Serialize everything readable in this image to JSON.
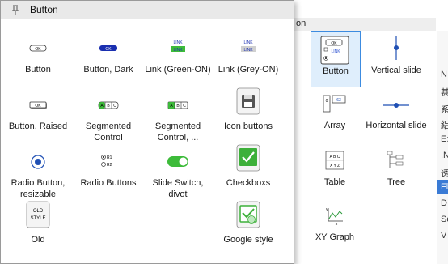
{
  "popup": {
    "title": "Button",
    "items": [
      {
        "label": "Button"
      },
      {
        "label": "Button, Dark"
      },
      {
        "label": "Link (Green-ON)"
      },
      {
        "label": "Link (Grey-ON)"
      },
      {
        "label": "Button, Raised"
      },
      {
        "label": "Segmented Control"
      },
      {
        "label": "Segmented Control, ..."
      },
      {
        "label": "Icon buttons"
      },
      {
        "label": "Radio Button, resizable"
      },
      {
        "label": "Radio Buttons"
      },
      {
        "label": "Slide Switch, divot"
      },
      {
        "label": "Checkboxs"
      },
      {
        "label": "Old"
      },
      {
        "label": "Google style"
      }
    ],
    "icon_text": {
      "ok": "OK",
      "link": "LINK",
      "segments": [
        "A",
        "B",
        "C"
      ],
      "radio_labels": [
        "R1",
        "R2"
      ],
      "old_style": [
        "OLD",
        "STYLE"
      ]
    }
  },
  "background": {
    "header_partial": "on",
    "items": [
      {
        "label": "Button"
      },
      {
        "label": "Vertical slide"
      },
      {
        "label": "Array"
      },
      {
        "label": "Horizontal slide"
      },
      {
        "label": "Table"
      },
      {
        "label": "Tree"
      },
      {
        "label": "XY Graph"
      }
    ],
    "icon_text": {
      "ok": "OK",
      "link": "LINK",
      "array_index": "0",
      "array_val": "63",
      "table_rows": [
        "A B C",
        "X Y Z"
      ],
      "xy": "x",
      "xy_y": "y"
    },
    "right_strip_chars": [
      "N",
      "甚",
      "系",
      "絽",
      "E:",
      ".N",
      "透",
      "Fl",
      "D",
      "Sc",
      "V"
    ]
  },
  "colors": {
    "accent_blue": "#3c8be0",
    "dark_button": "#1a2fb0",
    "green_on": "#3dbb3a",
    "checkbox_green": "#3db03a"
  }
}
